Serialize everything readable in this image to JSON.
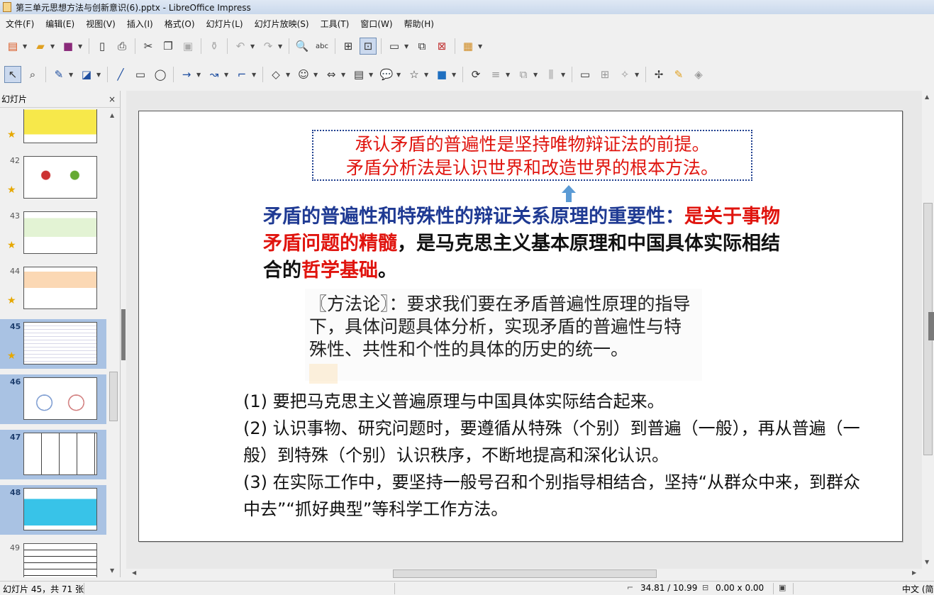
{
  "window": {
    "title": "第三单元思想方法与创新意识(6).pptx - LibreOffice Impress"
  },
  "menu": [
    "文件(F)",
    "编辑(E)",
    "视图(V)",
    "插入(I)",
    "格式(O)",
    "幻灯片(L)",
    "幻灯片放映(S)",
    "工具(T)",
    "窗口(W)",
    "帮助(H)"
  ],
  "sidepanel": {
    "title": "幻灯片",
    "close": "×",
    "slides": [
      {
        "num": "",
        "star": true,
        "selected": false
      },
      {
        "num": "42",
        "star": true,
        "selected": false
      },
      {
        "num": "43",
        "star": true,
        "selected": false
      },
      {
        "num": "44",
        "star": true,
        "selected": false
      },
      {
        "num": "45",
        "star": true,
        "selected": true
      },
      {
        "num": "46",
        "star": false,
        "selected": true
      },
      {
        "num": "47",
        "star": false,
        "selected": true
      },
      {
        "num": "48",
        "star": false,
        "selected": true
      },
      {
        "num": "49",
        "star": false,
        "selected": false
      }
    ]
  },
  "slide": {
    "topbox_line1": "承认矛盾的普遍性是坚持唯物辩证法的前提。",
    "topbox_line2": "矛盾分析法是认识世界和改造世界的根本方法。",
    "principle_blue": "矛盾的普遍性和特殊性的辩证关系原理的重要性：",
    "principle_red1": "是关于事物矛盾问题的精髓",
    "principle_black1": "，是马克思主义基本原理和中国具体实际相结合的",
    "principle_red2": "哲学基础",
    "principle_black2": "。",
    "methodology": "〖方法论〗：要求我们要在矛盾普遍性原理的指导下，具体问题具体分析，实现矛盾的普遍性与特殊性、共性和个性的具体的历史的统一。",
    "point1": "(1) 要把马克思主义普遍原理与中国具体实际结合起来。",
    "point2": "(2) 认识事物、研究问题时，要遵循从特殊（个别）到普遍（一般），再从普遍（一般）到特殊（个别）认识秩序，不断地提高和深化认识。",
    "point3": "(3) 在实际工作中，要坚持一般号召和个别指导相结合，坚持“从群众中来，到群众中去”“抓好典型”等科学工作方法。"
  },
  "status": {
    "slide_info": "幻灯片 45，共 71 张",
    "position": "34.81 / 10.99",
    "size": "0.00 x 0.00",
    "language": "中文 (简"
  },
  "colors": {
    "accent_red": "#e0140e",
    "accent_blue": "#1f3a93",
    "selection": "#a9c2e3"
  }
}
